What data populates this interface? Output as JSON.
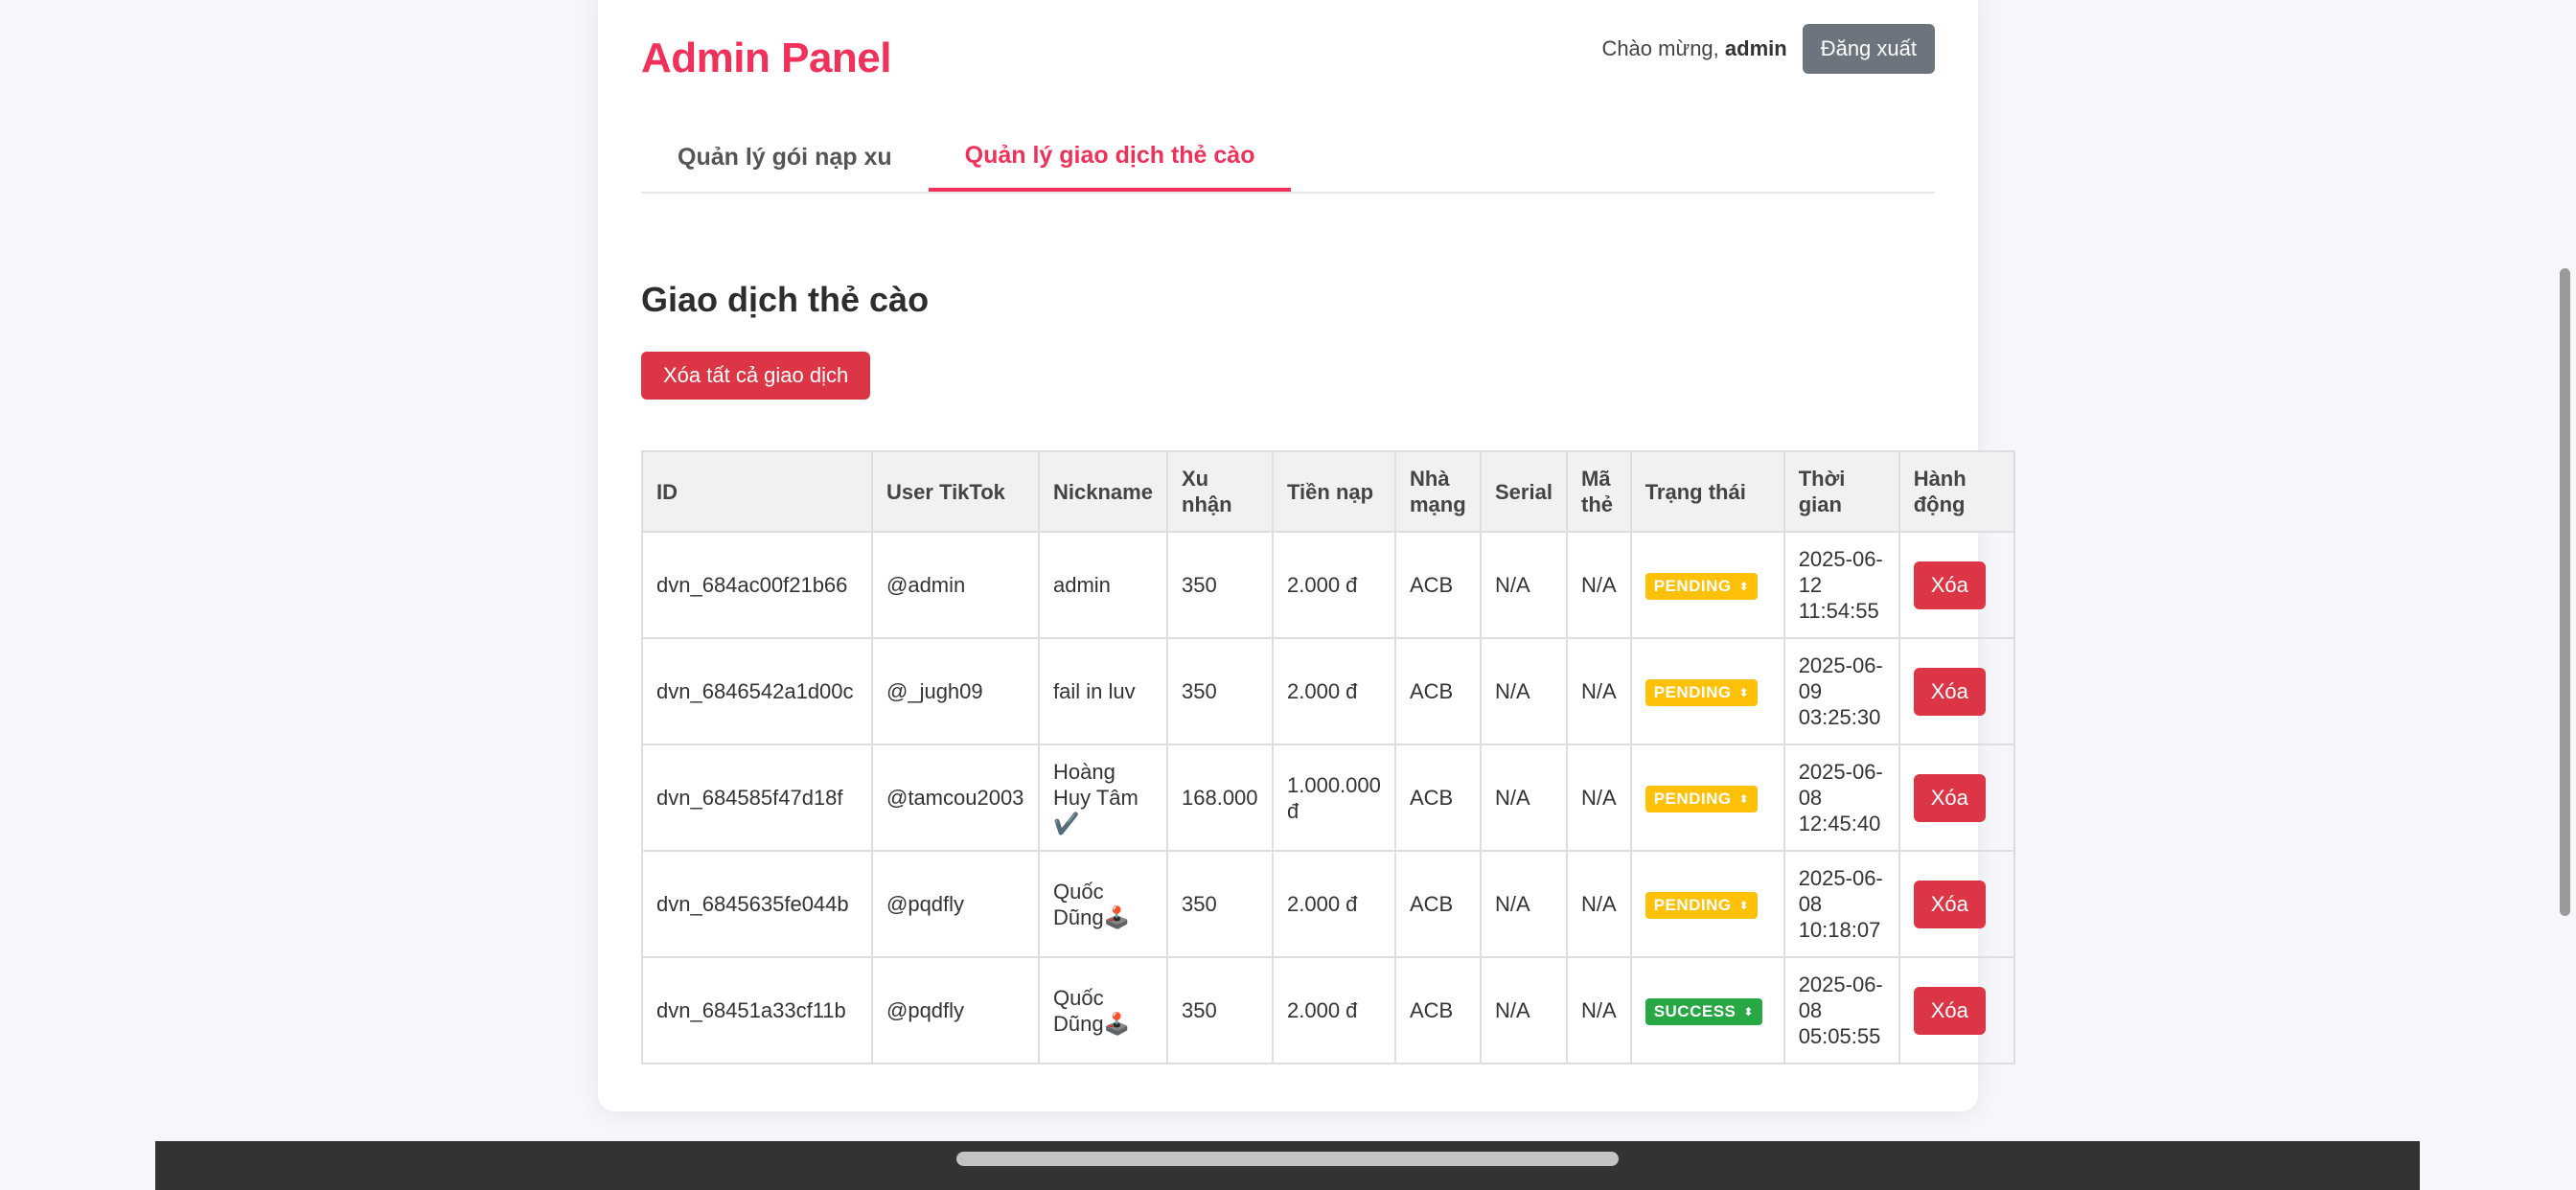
{
  "header": {
    "title": "Admin Panel",
    "welcome_prefix": "Chào mừng, ",
    "username": "admin",
    "logout_label": "Đăng xuất"
  },
  "tabs": [
    {
      "label": "Quản lý gói nạp xu",
      "active": false
    },
    {
      "label": "Quản lý giao dịch thẻ cào",
      "active": true
    }
  ],
  "section": {
    "title": "Giao dịch thẻ cào",
    "clear_all_label": "Xóa tất cả giao dịch"
  },
  "table": {
    "columns": [
      "ID",
      "User TikTok",
      "Nickname",
      "Xu nhận",
      "Tiền nạp",
      "Nhà mạng",
      "Serial",
      "Mã thẻ",
      "Trạng thái",
      "Thời gian",
      "Hành động"
    ],
    "rows": [
      {
        "id": "dvn_684ac00f21b66",
        "user": "@admin",
        "nickname": "admin",
        "xu": "350",
        "tien": "2.000 đ",
        "nha_mang": "ACB",
        "serial": "N/A",
        "ma_the": "N/A",
        "status": "PENDING",
        "time": "2025-06-12 11:54:55",
        "action": "Xóa"
      },
      {
        "id": "dvn_6846542a1d00c",
        "user": "@_jugh09",
        "nickname": "fail in luv",
        "xu": "350",
        "tien": "2.000 đ",
        "nha_mang": "ACB",
        "serial": "N/A",
        "ma_the": "N/A",
        "status": "PENDING",
        "time": "2025-06-09 03:25:30",
        "action": "Xóa"
      },
      {
        "id": "dvn_684585f47d18f",
        "user": "@tamcou2003",
        "nickname": "Hoàng Huy Tâm ✔️",
        "xu": "168.000",
        "tien": "1.000.000 đ",
        "nha_mang": "ACB",
        "serial": "N/A",
        "ma_the": "N/A",
        "status": "PENDING",
        "time": "2025-06-08 12:45:40",
        "action": "Xóa"
      },
      {
        "id": "dvn_6845635fe044b",
        "user": "@pqdfly",
        "nickname": "Quốc Dũng🕹️",
        "xu": "350",
        "tien": "2.000 đ",
        "nha_mang": "ACB",
        "serial": "N/A",
        "ma_the": "N/A",
        "status": "PENDING",
        "time": "2025-06-08 10:18:07",
        "action": "Xóa"
      },
      {
        "id": "dvn_68451a33cf11b",
        "user": "@pqdfly",
        "nickname": "Quốc Dũng🕹️",
        "xu": "350",
        "tien": "2.000 đ",
        "nha_mang": "ACB",
        "serial": "N/A",
        "ma_the": "N/A",
        "status": "SUCCESS",
        "time": "2025-06-08 05:05:55",
        "action": "Xóa"
      }
    ]
  },
  "colors": {
    "brand": "#f0325a",
    "danger": "#dc3545",
    "pending": "#ffc107",
    "success": "#28a745",
    "logout": "#6c757d"
  }
}
